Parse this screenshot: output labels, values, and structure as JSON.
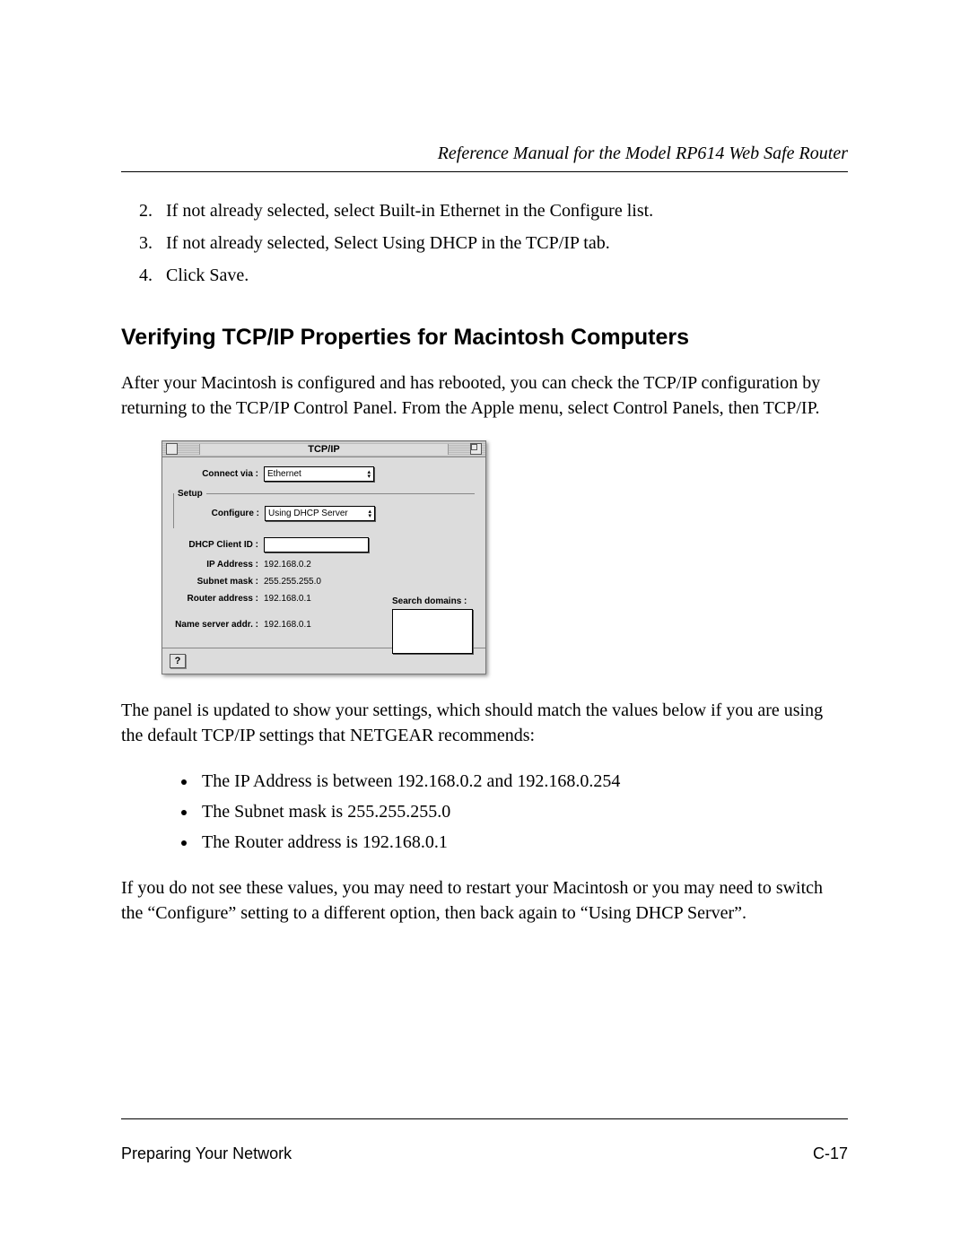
{
  "header": {
    "title": "Reference Manual for the Model RP614 Web Safe Router"
  },
  "steps": {
    "s2": "If not already selected, select Built-in Ethernet in the Configure list.",
    "s3": "If not already selected, Select Using DHCP in the TCP/IP tab.",
    "s4": "Click Save."
  },
  "heading": "Verifying TCP/IP Properties for Macintosh Computers",
  "para1": "After your Macintosh is configured and has rebooted, you can check the TCP/IP configuration by returning to the TCP/IP Control Panel. From the Apple menu, select Control Panels, then TCP/IP.",
  "panel": {
    "window_title": "TCP/IP",
    "setup_legend": "Setup",
    "labels": {
      "connect_via": "Connect via :",
      "configure": "Configure :",
      "dhcp_client_id": "DHCP Client ID :",
      "ip_address": "IP Address :",
      "subnet_mask": "Subnet mask :",
      "router_address": "Router address :",
      "name_server": "Name server addr. :",
      "search_domains": "Search domains :"
    },
    "values": {
      "connect_via": "Ethernet",
      "configure": "Using DHCP Server",
      "dhcp_client_id": "",
      "ip_address": "192.168.0.2",
      "subnet_mask": "255.255.255.0",
      "router_address": "192.168.0.1",
      "name_server": "192.168.0.1"
    },
    "help_glyph": "?"
  },
  "para2": "The panel is updated to show your settings, which should match the values below if you are using the default TCP/IP settings that NETGEAR recommends:",
  "bullets": {
    "b1": "The IP Address is between 192.168.0.2 and 192.168.0.254",
    "b2": "The Subnet mask is 255.255.255.0",
    "b3": "The Router address is 192.168.0.1"
  },
  "para3": "If you do not see these values, you may need to restart your Macintosh or you may need to switch the “Configure” setting to a different option, then back again to “Using DHCP Server”.",
  "footer": {
    "section": "Preparing Your Network",
    "page_num": "C-17"
  }
}
